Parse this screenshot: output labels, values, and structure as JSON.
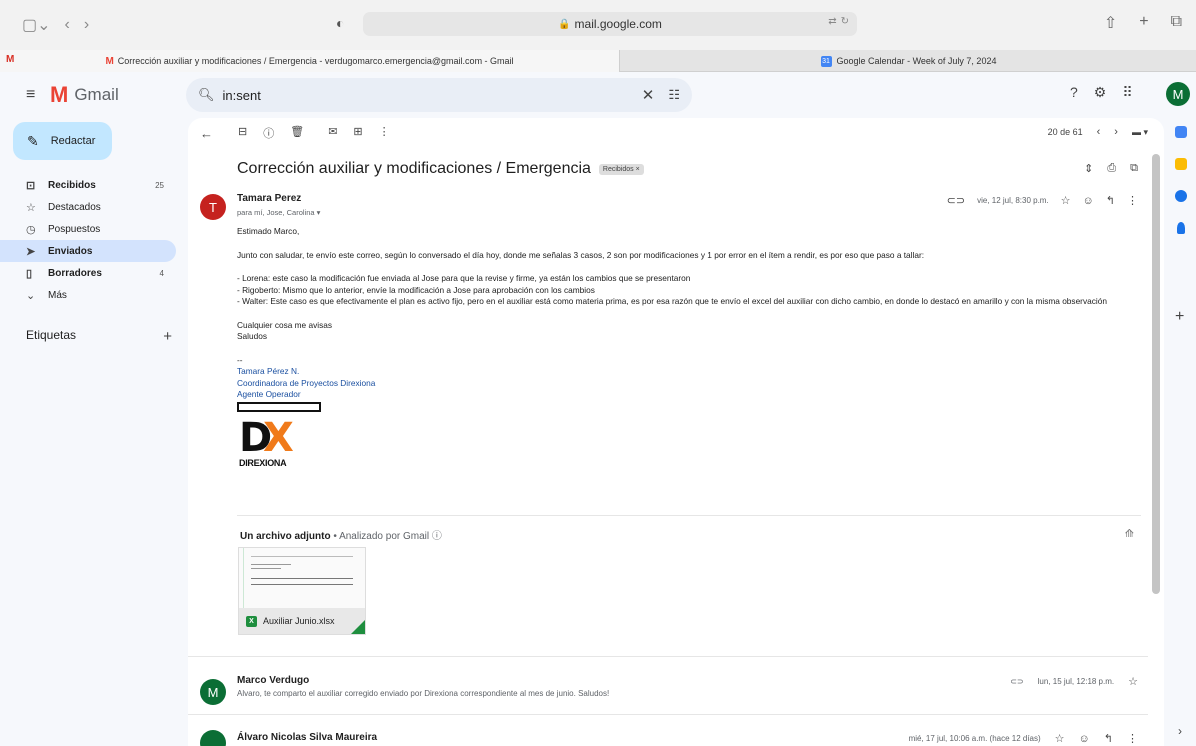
{
  "browser": {
    "url": "mail.google.com",
    "tabs": [
      {
        "label": "Corrección auxiliar y modificaciones / Emergencia - verdugomarco.emergencia@gmail.com - Gmail"
      },
      {
        "label": "Google Calendar - Week of July 7, 2024"
      }
    ]
  },
  "gmail": {
    "brand": "Gmail",
    "search_value": "in:sent",
    "account_initial": "M"
  },
  "sidebar": {
    "compose": "Redactar",
    "items": [
      {
        "label": "Recibidos",
        "count": "25",
        "icon": "inbox-icon"
      },
      {
        "label": "Destacados",
        "count": "",
        "icon": "star-icon"
      },
      {
        "label": "Pospuestos",
        "count": "",
        "icon": "clock-icon"
      },
      {
        "label": "Enviados",
        "count": "",
        "icon": "send-icon"
      },
      {
        "label": "Borradores",
        "count": "4",
        "icon": "draft-icon"
      },
      {
        "label": "Más",
        "count": "",
        "icon": "chevron-down-icon"
      }
    ],
    "labels_title": "Etiquetas"
  },
  "toolbar": {
    "pagination": "20 de 61"
  },
  "thread": {
    "subject": "Corrección auxiliar y modificaciones / Emergencia",
    "label_badge": "Recibidos ×",
    "message1": {
      "avatar": "T",
      "sender": "Tamara Perez",
      "recipients": "para mí, Jose, Carolina ▾",
      "date": "vie, 12 jul, 8:30 p.m.",
      "greeting": "Estimado Marco,",
      "para1": "Junto con saludar, te envío este correo, según lo conversado el día hoy, donde me señalas 3 casos, 2  son por modificaciones y 1 por error en el ítem a rendir, es por eso que paso a tallar:",
      "bullet1": "- Lorena: este caso la modificación fue enviada al Jose para que la revise y firme, ya están los cambios que se presentaron",
      "bullet2": "- Rigoberto: Mismo que lo anterior, envíe la modificación a Jose para aprobación con los cambios",
      "bullet3": "- Walter: Este caso es que efectivamente el plan es activo fijo, pero en el auxiliar está como materia prima, es por esa razón que te envío el excel del auxiliar con dicho cambio, en donde lo destacó en amarillo y con la misma observación",
      "closing1": "Cualquier cosa me avisas",
      "closing2": "Saludos",
      "sig_dash": "--",
      "sig_name": "Tamara Pérez N.",
      "sig_title": "Coordinadora de Proyectos Direxiona",
      "sig_role": "Agente Operador",
      "logo_text": "DIREXIONA",
      "attachment_header": "Un archivo adjunto",
      "attachment_sub": " • Analizado por Gmail ⓘ",
      "attachment_name": "Auxiliar Junio.xlsx"
    },
    "message2": {
      "avatar": "M",
      "sender": "Marco Verdugo",
      "snippet": "Alvaro, te comparto el auxiliar corregido enviado por Direxiona correspondiente al mes de junio. Saludos!",
      "date": "lun, 15 jul, 12:18 p.m."
    },
    "message3": {
      "sender": "Álvaro Nicolas Silva Maureira",
      "date": "mié, 17 jul, 10:06 a.m. (hace 12 días)"
    }
  },
  "colors": {
    "compose_bg": "#c2e7ff",
    "active_nav": "#d3e3fd",
    "avatar_red": "#c5221f",
    "avatar_green": "#0b6e35",
    "signature_blue": "#1a4fa0",
    "logo_orange": "#f07a1a"
  }
}
